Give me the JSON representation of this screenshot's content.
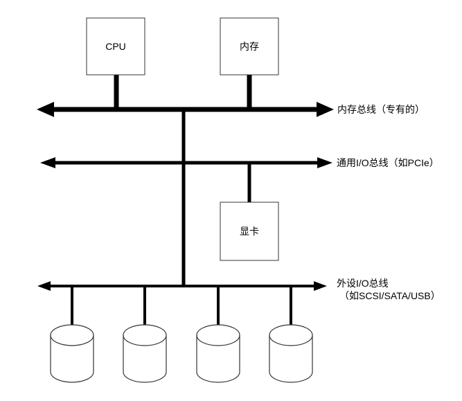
{
  "colors": {
    "line": "#000000",
    "box_fill": "#ffffff",
    "box_stroke": "#333333"
  },
  "nodes": {
    "cpu": "CPU",
    "memory": "内存",
    "gpu": "显卡"
  },
  "buses": {
    "memory_bus": "内存总线（专有的）",
    "io_bus": "通用I/O总线（如PCIe）",
    "peripheral_bus_line1": "外设I/O总线",
    "peripheral_bus_line2": "（如SCSI/SATA/USB）"
  },
  "disks": [
    {
      "icon": "disk-cylinder-icon"
    },
    {
      "icon": "disk-cylinder-icon"
    },
    {
      "icon": "disk-cylinder-icon"
    },
    {
      "icon": "disk-cylinder-icon"
    }
  ]
}
